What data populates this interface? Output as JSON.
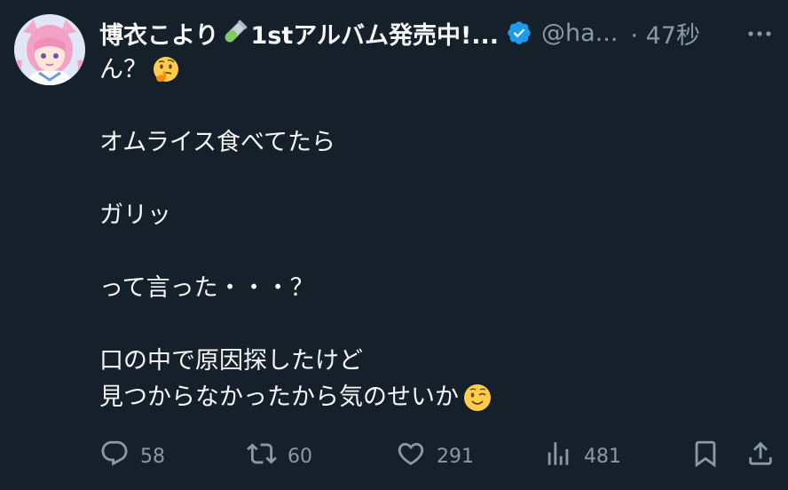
{
  "tweet": {
    "display_name": "博衣こより",
    "display_name_tail": "1stアルバム発売中!...",
    "handle": "@ha...",
    "timestamp": "· 47秒",
    "body_lines": [
      "ん？",
      "",
      "オムライス食べてたら",
      "",
      "ガリッ",
      "",
      "って言った・・・？",
      "",
      "口の中で原因探したけど",
      "見つからなかったから気のせいか"
    ],
    "emojis": {
      "line_0": "thinking-face",
      "line_9": "winking-face",
      "name": "test-tube"
    },
    "colors": {
      "background": "#15202b",
      "text": "#f7f9f9",
      "muted": "#8b98a5",
      "verified": "#1d9bf0"
    }
  },
  "actions": {
    "reply_count": "58",
    "retweet_count": "60",
    "like_count": "291",
    "view_count": "481"
  }
}
